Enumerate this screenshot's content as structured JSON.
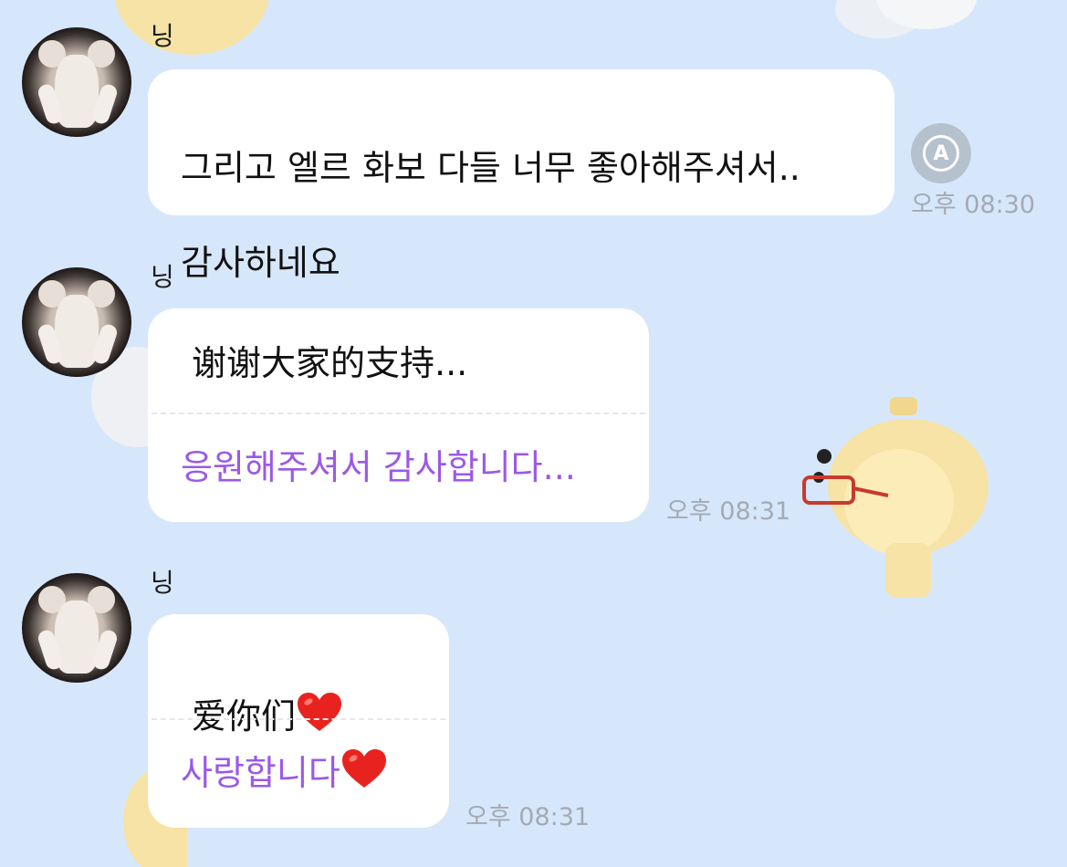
{
  "messages": [
    {
      "sender": "닝",
      "text_line1": "그리고 엘르 화보 다들 너무 좋아해주셔서..",
      "text_line2": "감사하네요",
      "time": "오후 08:30",
      "translate_icon_label": "A"
    },
    {
      "sender": "닝",
      "text": "谢谢大家的支持...",
      "translation": "응원해주셔서 감사합니다...",
      "time": "오후 08:31"
    },
    {
      "sender": "닝",
      "text": "爱你们",
      "translation": "사랑합니다",
      "time": "오후 08:31"
    }
  ],
  "icons": {
    "translate": "translate-icon",
    "pleading_face": "pleading-face-emoji",
    "leg": "leg-emoji",
    "heart": "red-heart-emoji"
  },
  "colors": {
    "background": "#d7e7fb",
    "bubble": "#ffffff",
    "translation_text": "#9b59e6",
    "timestamp": "#a3aab4"
  }
}
